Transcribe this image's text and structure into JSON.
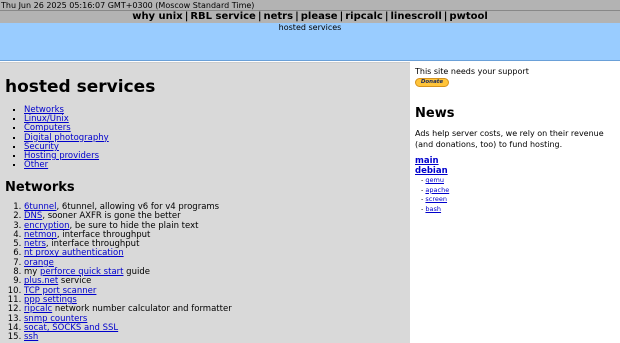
{
  "topbar": {
    "datetime": "Thu Jun 26 2025 05:16:07 GMT+0300 (Moscow Standard Time)"
  },
  "nav": {
    "items": [
      "why unix",
      "RBL service",
      "netrs",
      "please",
      "ripcalc",
      "linescroll",
      "pwtool"
    ],
    "separator": "|"
  },
  "banner": {
    "text": "hosted services"
  },
  "colors": {
    "topbar": "#b3b3b3",
    "banner": "#99ccff",
    "main_panel": "#d9d9d9",
    "link": "#0000cc",
    "donate": "#ffc43a"
  },
  "main": {
    "title": "hosted services",
    "toc": [
      "Networks",
      "Linux/Unix",
      "Computers",
      "Digital photography",
      "Security",
      "Hosting providers",
      "Other"
    ],
    "section_title": "Networks",
    "networks": [
      {
        "link": "6tunnel",
        "text": ", 6tunnel, allowing v6 for v4 programs",
        "prefix": ""
      },
      {
        "link": "DNS",
        "text": ", sooner AXFR is gone the better",
        "prefix": ""
      },
      {
        "link": "encryption",
        "text": ", be sure to hide the plain text",
        "prefix": ""
      },
      {
        "link": "netmon",
        "text": ", interface throughput",
        "prefix": ""
      },
      {
        "link": "netrs",
        "text": ", interface throughput",
        "prefix": ""
      },
      {
        "link": "nt proxy authentication",
        "text": "",
        "prefix": ""
      },
      {
        "link": "orange",
        "text": "",
        "prefix": ""
      },
      {
        "link": "perforce quick start",
        "text": " guide",
        "prefix": "my "
      },
      {
        "link": "plus.net",
        "text": " service",
        "prefix": ""
      },
      {
        "link": "TCP port scanner",
        "text": "",
        "prefix": ""
      },
      {
        "link": "ppp settings",
        "text": "",
        "prefix": ""
      },
      {
        "link": "ripcalc",
        "text": " network number calculator and formatter",
        "prefix": ""
      },
      {
        "link": "snmp counters",
        "text": "",
        "prefix": ""
      },
      {
        "link": "socat, SOCKS and SSL",
        "text": "",
        "prefix": ""
      },
      {
        "link": "ssh",
        "text": "",
        "prefix": ""
      }
    ]
  },
  "sidebar": {
    "support_text": "This site needs your support",
    "donate_label": "Donate",
    "news_title": "News",
    "news_body": "Ads help server costs, we rely on their revenue (and donations, too) to fund hosting.",
    "debian_links": [
      "main",
      "debian"
    ],
    "packages": [
      "qemu",
      "apache",
      "screen",
      "bash"
    ]
  }
}
